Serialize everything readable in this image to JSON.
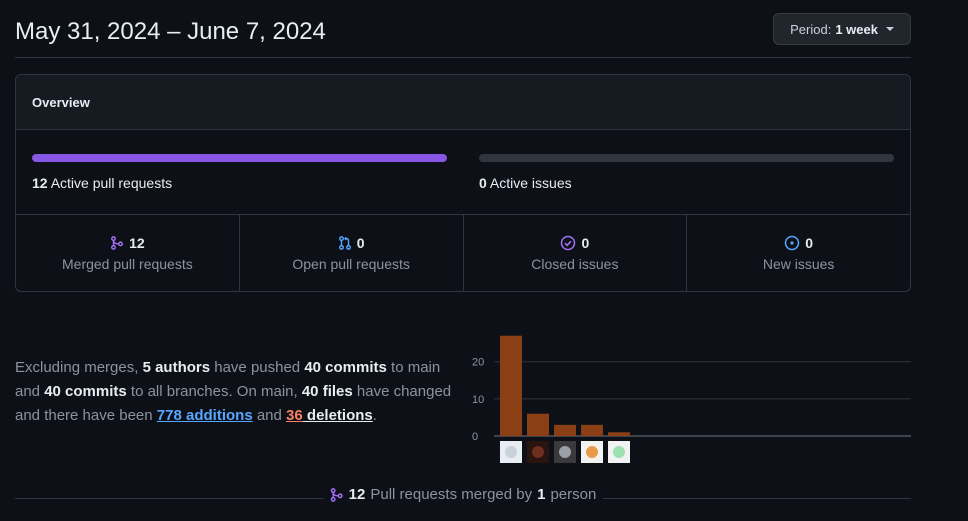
{
  "header": {
    "title": "May 31, 2024 – June 7, 2024",
    "period_label": "Period:",
    "period_value": "1 week"
  },
  "overview": {
    "title": "Overview",
    "active_prs": {
      "count": "12",
      "label": "Active pull requests",
      "fill_fraction": 1.0
    },
    "active_issues": {
      "count": "0",
      "label": "Active issues",
      "fill_fraction": 0.0
    },
    "stats": [
      {
        "value": "12",
        "label": "Merged pull requests",
        "icon": "git-merge-icon",
        "color": "#a371f7"
      },
      {
        "value": "0",
        "label": "Open pull requests",
        "icon": "git-pull-request-icon",
        "color": "#58a6ff"
      },
      {
        "value": "0",
        "label": "Closed issues",
        "icon": "issue-closed-icon",
        "color": "#a371f7"
      },
      {
        "value": "0",
        "label": "New issues",
        "icon": "issue-opened-icon",
        "color": "#58a6ff"
      }
    ]
  },
  "summary": {
    "t1": "Excluding merges, ",
    "authors": "5 authors",
    "t2": " have pushed ",
    "commits_main": "40 commits",
    "t3": " to main and ",
    "commits_all": "40 commits",
    "t4": " to all branches. On main, ",
    "files": "40 files",
    "t5": " have changed and there have been ",
    "additions_num": "778",
    "additions_word": " additions",
    "t6": " and ",
    "deletions_num": "36",
    "deletions_word": " deletions",
    "t7": "."
  },
  "chart_data": {
    "type": "bar",
    "categories": [
      "author-1",
      "author-2",
      "author-3",
      "author-4",
      "author-5"
    ],
    "values": [
      27,
      6,
      3,
      3,
      1
    ],
    "yticks": [
      "0",
      "10",
      "20"
    ],
    "ylim": [
      0,
      28
    ],
    "bar_color": "#8b3f14",
    "grid": true
  },
  "footer": {
    "count": "12",
    "t1": " Pull requests merged by ",
    "persons": "1",
    "t2": " person"
  },
  "colors": {
    "accent_purple": "#8957e5",
    "blue": "#58a6ff",
    "orange": "#f78166"
  }
}
